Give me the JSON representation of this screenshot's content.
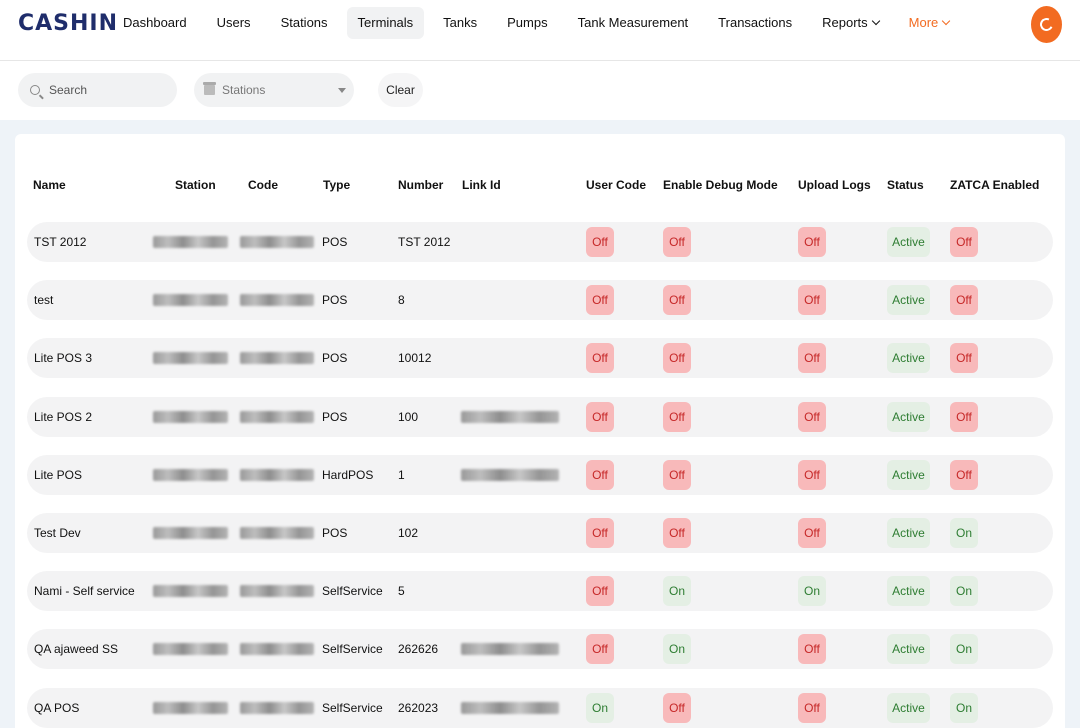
{
  "app": {
    "logo": "CASHIN"
  },
  "nav": {
    "items": [
      "Dashboard",
      "Users",
      "Stations",
      "Terminals",
      "Tanks",
      "Pumps",
      "Tank Measurement",
      "Transactions"
    ],
    "reports": "Reports",
    "more": "More",
    "active": "Terminals"
  },
  "colors": {
    "brand": "#1f2d6b",
    "accent": "#f26b21",
    "off_bg": "#f8b9ba",
    "off_text": "#c62828",
    "on_bg": "#e4efe4",
    "on_text": "#2e7d32"
  },
  "filters": {
    "search_placeholder": "Search",
    "stations_placeholder": "Stations",
    "clear_label": "Clear"
  },
  "table": {
    "headers": {
      "name": "Name",
      "station": "Station",
      "code": "Code",
      "type": "Type",
      "number": "Number",
      "link_id": "Link Id",
      "user_code": "User Code",
      "debug": "Enable Debug Mode",
      "upload_logs": "Upload Logs",
      "status": "Status",
      "zatca": "ZATCA Enabled"
    },
    "rows": [
      {
        "name": "TST 2012",
        "type": "POS",
        "number": "TST 2012",
        "link_id_redacted": false,
        "user_code": "Off",
        "debug": "Off",
        "upload_logs": "Off",
        "status": "Active",
        "zatca": "Off"
      },
      {
        "name": "test",
        "type": "POS",
        "number": "8",
        "link_id_redacted": false,
        "user_code": "Off",
        "debug": "Off",
        "upload_logs": "Off",
        "status": "Active",
        "zatca": "Off"
      },
      {
        "name": "Lite POS 3",
        "type": "POS",
        "number": "10012",
        "link_id_redacted": false,
        "user_code": "Off",
        "debug": "Off",
        "upload_logs": "Off",
        "status": "Active",
        "zatca": "Off"
      },
      {
        "name": "Lite POS 2",
        "type": "POS",
        "number": "100",
        "link_id_redacted": true,
        "user_code": "Off",
        "debug": "Off",
        "upload_logs": "Off",
        "status": "Active",
        "zatca": "Off"
      },
      {
        "name": "Lite POS",
        "type": "HardPOS",
        "number": "1",
        "link_id_redacted": true,
        "user_code": "Off",
        "debug": "Off",
        "upload_logs": "Off",
        "status": "Active",
        "zatca": "Off"
      },
      {
        "name": "Test Dev",
        "type": "POS",
        "number": "102",
        "link_id_redacted": false,
        "user_code": "Off",
        "debug": "Off",
        "upload_logs": "Off",
        "status": "Active",
        "zatca": "On"
      },
      {
        "name": "Nami - Self service",
        "type": "SelfService",
        "number": "5",
        "link_id_redacted": false,
        "user_code": "Off",
        "debug": "On",
        "upload_logs": "On",
        "status": "Active",
        "zatca": "On"
      },
      {
        "name": "QA ajaweed SS",
        "type": "SelfService",
        "number": "262626",
        "link_id_redacted": true,
        "user_code": "Off",
        "debug": "On",
        "upload_logs": "Off",
        "status": "Active",
        "zatca": "On"
      },
      {
        "name": "QA POS",
        "type": "SelfService",
        "number": "262023",
        "link_id_redacted": true,
        "user_code": "On",
        "debug": "Off",
        "upload_logs": "Off",
        "status": "Active",
        "zatca": "On"
      }
    ]
  }
}
